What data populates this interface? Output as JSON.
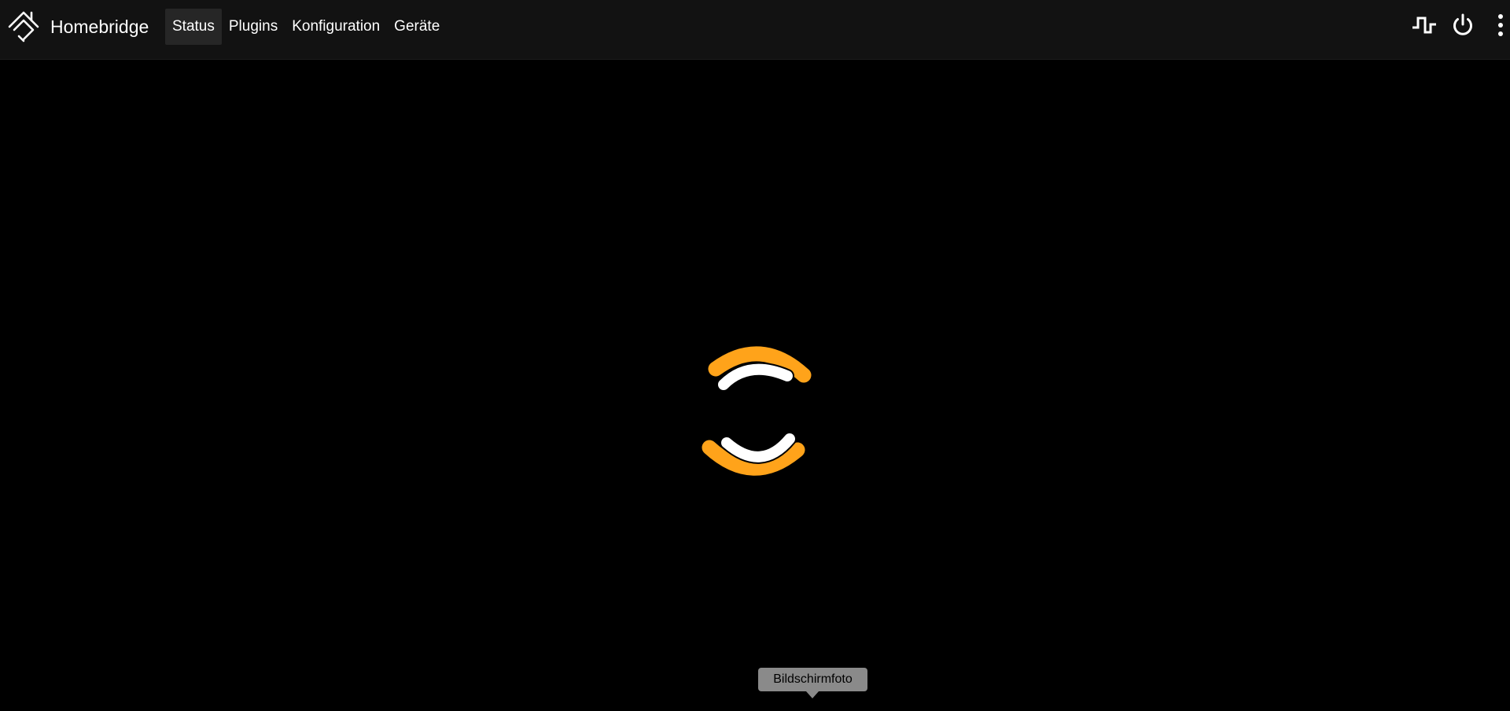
{
  "app": {
    "name": "Homebridge",
    "logo_icon": "homebridge-logo-icon"
  },
  "nav": {
    "items": [
      {
        "label": "Status",
        "active": true
      },
      {
        "label": "Plugins",
        "active": false
      },
      {
        "label": "Konfiguration",
        "active": false
      },
      {
        "label": "Geräte",
        "active": false
      }
    ]
  },
  "toolbar": {
    "icons": [
      "pulse-icon",
      "power-icon",
      "more-vertical-icon"
    ]
  },
  "main": {
    "loading_indicator": "homebridge-loading-spinner"
  },
  "tooltip": {
    "text": "Bildschirmfoto"
  },
  "colors": {
    "accent": "#ffa31a",
    "spinner_inner": "#ffffff",
    "navbar_bg": "#121212",
    "active_tab_bg": "#262626",
    "page_bg": "#000000",
    "tooltip_bg": "#8a8a8a"
  }
}
